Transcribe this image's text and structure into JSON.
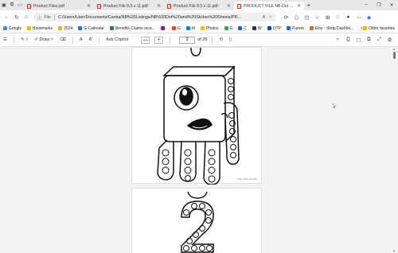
{
  "tabs": [
    {
      "title": "Product Files.pdf",
      "active": false
    },
    {
      "title": "Product File 8.5 x 11.pdf",
      "active": false
    },
    {
      "title": "Product File 8.5 x 11.pdf",
      "active": false
    },
    {
      "title": "PRODUCT FILE NB Dot marker",
      "active": true
    }
  ],
  "address": {
    "file_label": "File",
    "url": "C:/Users/User/Documents/Camia/NB%20Listings/NB%20Dot%20and%20Sticker%20Sheets/PR..."
  },
  "bookmarks": {
    "items": [
      {
        "label": "Google",
        "color": "#4285f4"
      },
      {
        "label": "Bookmarks",
        "color": "#f2b400"
      },
      {
        "label": "2024",
        "color": "#f2b400"
      },
      {
        "label": "G Calendar",
        "color": "#1a73e8"
      },
      {
        "label": "Benefits Claims rece...",
        "color": "#2e7d32"
      },
      {
        "label": "",
        "color": "#7b1fa2"
      },
      {
        "label": "G",
        "color": "#ea4335"
      },
      {
        "label": "Id",
        "color": "#0288d1"
      },
      {
        "label": "Photos",
        "color": "#fbbc04"
      },
      {
        "label": "G",
        "color": "#34a853"
      },
      {
        "label": "C",
        "color": "#1565c0"
      },
      {
        "label": "W",
        "color": "#333333"
      },
      {
        "label": "OTP",
        "color": "#0d47a1"
      },
      {
        "label": "Parent",
        "color": "#1976d2"
      },
      {
        "label": "Etsy - Shop Dashbo...",
        "color": "#f1641e"
      }
    ],
    "other": "Other favorites"
  },
  "pdf_toolbar": {
    "draw_label": "Draw",
    "ask_copilot": "Ask Copilot",
    "zoom_out": "—",
    "zoom_in": "+",
    "page_number": "2",
    "page_total": "of 26"
  },
  "page1": {
    "watermark": "© Twin Teach and 2024"
  },
  "colors": {
    "accent": "#1a73e8",
    "pdf_red": "#c42b1c"
  }
}
